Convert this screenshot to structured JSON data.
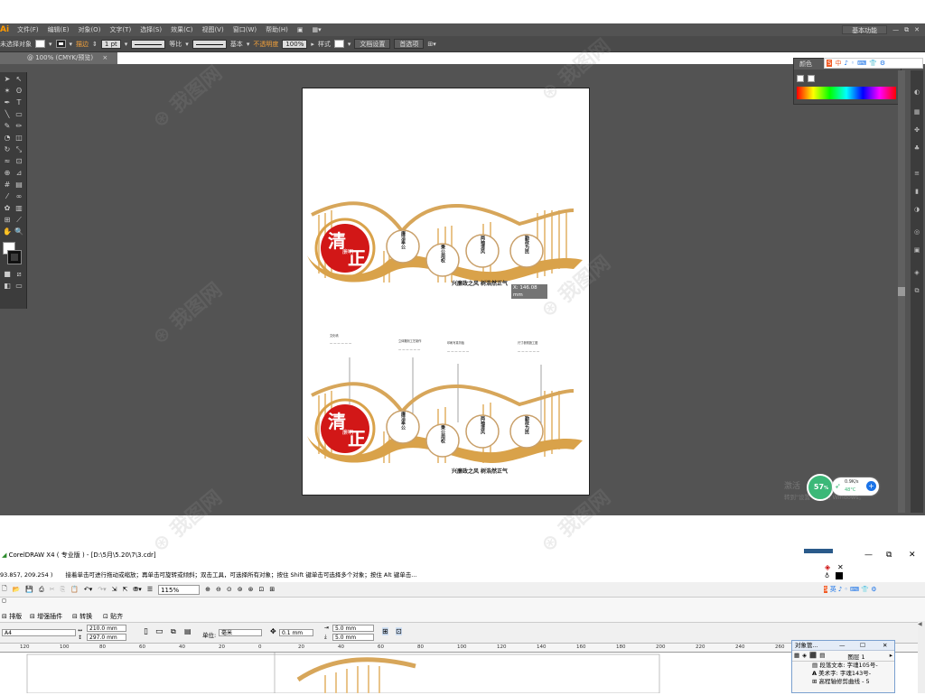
{
  "illustrator": {
    "logo": "Ai",
    "menu": [
      "文件(F)",
      "编辑(E)",
      "对象(O)",
      "文字(T)",
      "选择(S)",
      "效果(C)",
      "视图(V)",
      "窗口(W)",
      "帮助(H)"
    ],
    "workspace": "基本功能",
    "window_controls": [
      "—",
      "⧉",
      "✕"
    ],
    "control_bar": {
      "selection": "未选择对象",
      "stroke_label": "描边",
      "stroke_weight": "1 pt",
      "profile": "等比",
      "brush": "基本",
      "opacity_label": "不透明度",
      "opacity": "100%",
      "style_label": "样式",
      "doc_setup": "文档设置",
      "preferences": "首选项"
    },
    "doc_tab": "@ 100% (CMYK/预览)",
    "doc_tab_close": "×",
    "color_panel_title": "颜色",
    "sogou": [
      "中",
      "♪",
      "◦",
      "⌨",
      "👕",
      "⚙"
    ],
    "measure": {
      "x": "X: 146.08 mm",
      "y": "Y: 143.93 mm"
    }
  },
  "artwork": {
    "big_char_1": "清",
    "big_char_2": "正",
    "small_text": "廉明",
    "circles": [
      "廉洁奉公",
      "秉公用权",
      "两袖清风",
      "勤政为民"
    ],
    "slogan": "兴廉政之风 树浩然正气",
    "notes": [
      "文化墙",
      "立体雕刻工艺制作",
      "印刷写真背板",
      "尺寸参照施工图"
    ]
  },
  "windows_notice": {
    "line1": "激活",
    "line2": "转到\"设置\"以激活 Windows。"
  },
  "net_widget": {
    "percent": "57",
    "unit": "%",
    "up": "0.9K/s",
    "temp": "48°C"
  },
  "coreldraw": {
    "title": "CorelDRAW X4 ( 专业版 ) - [D:\\5月\\5.20\\7\\3.cdr]",
    "status_coords": "93.857, 209.254 )",
    "status_hint": "接着单击可进行拖动或缩放；再单击可旋转或倾斜；双击工具，可选择所有对象；按住 Shift 键单击可选择多个对象；按住 Alt 键单击...",
    "zoom": "115%",
    "row3_items": [
      "排版",
      "增强插件",
      "转换",
      "贴齐"
    ],
    "page_size": "A4",
    "width": "210.0 mm",
    "height": "297.0 mm",
    "unit_label": "单位:",
    "unit": "毫米",
    "nudge": "0.1 mm",
    "dup_x": "5.0 mm",
    "dup_y": "5.0 mm",
    "ruler_ticks": [
      "120",
      "100",
      "80",
      "60",
      "40",
      "20",
      "0",
      "20",
      "40",
      "60",
      "80",
      "100",
      "120",
      "140",
      "160",
      "180",
      "200",
      "220",
      "240",
      "260",
      "280"
    ],
    "object_manager": {
      "title": "对象管...",
      "layer": "图层 1",
      "items": [
        "段落文本: 字魂105号-",
        "美术字: 字魂143号-",
        "高程轴修剪曲线 - 5"
      ]
    }
  },
  "watermark_text": "我图网"
}
